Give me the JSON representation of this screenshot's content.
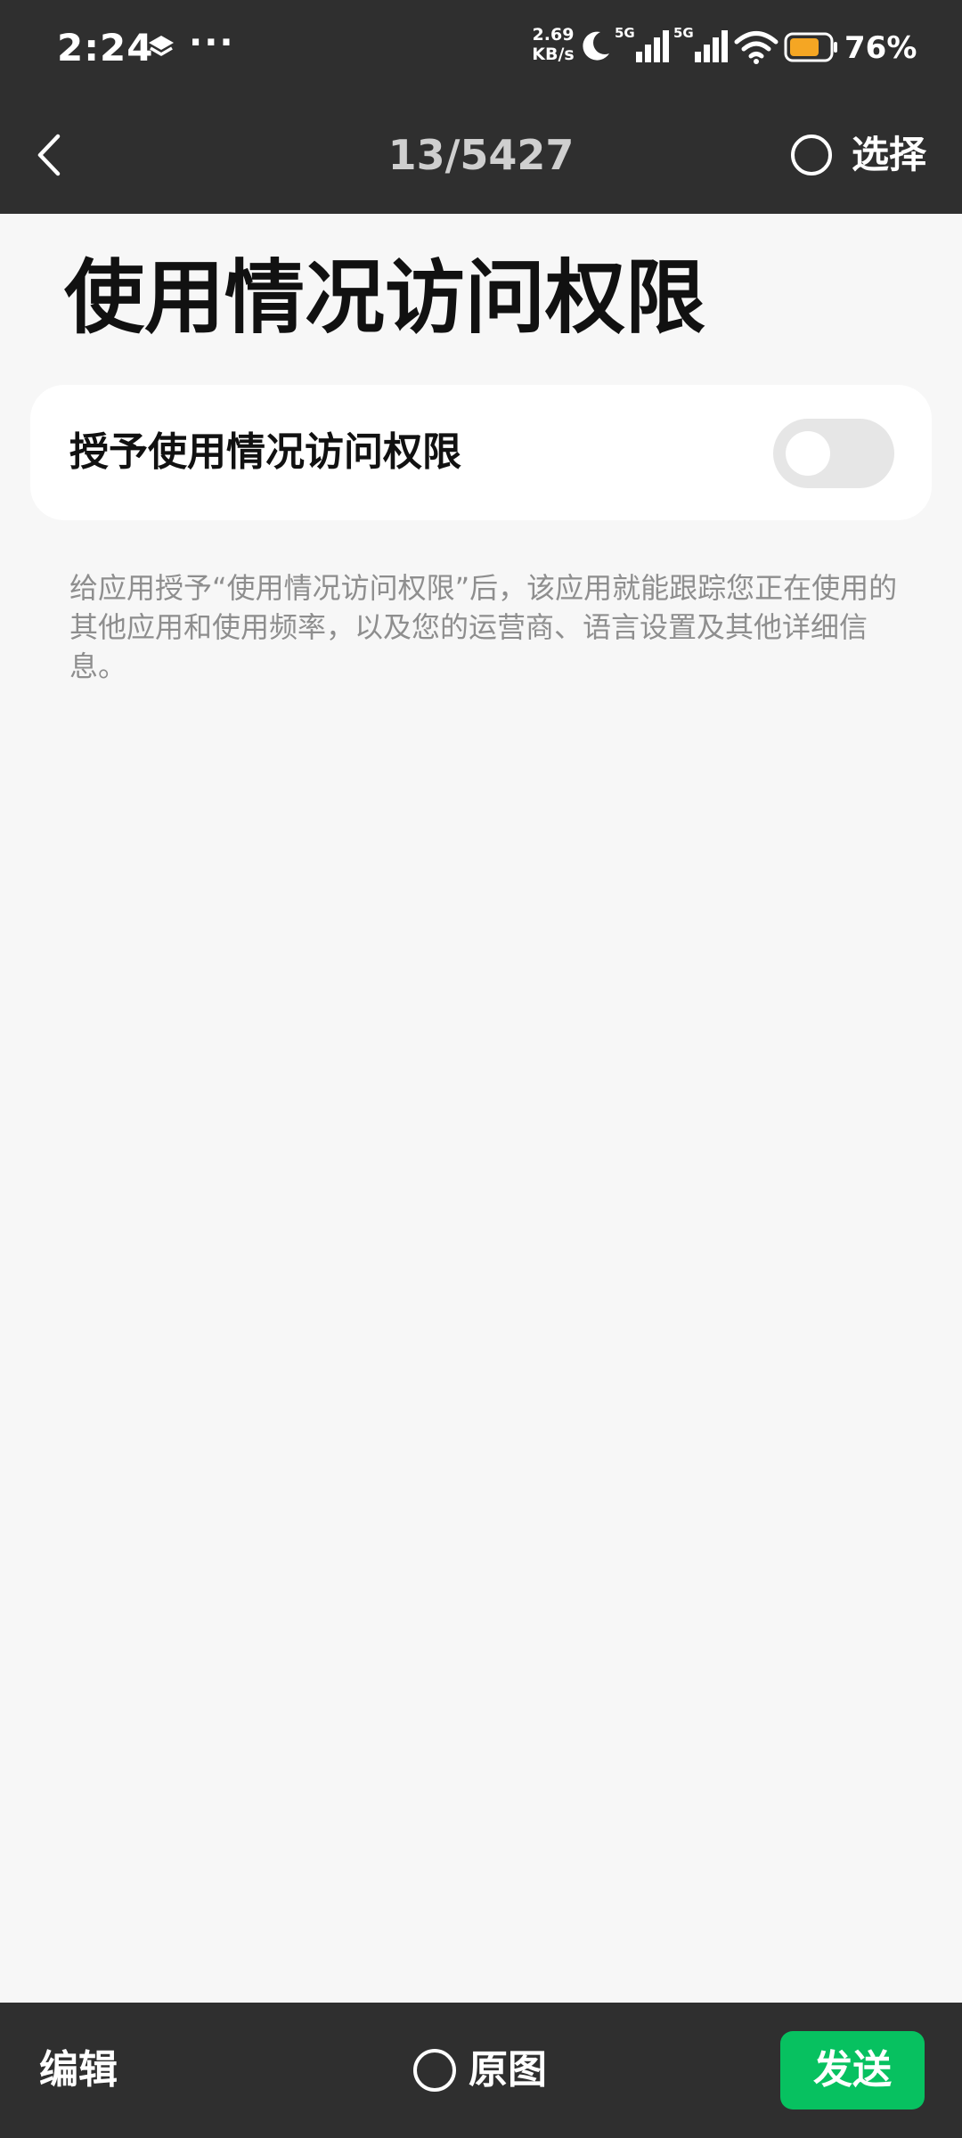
{
  "status_bar": {
    "time": "2:24",
    "more_dots": "···",
    "net_speed_value": "2.69",
    "net_speed_unit": "KB/s",
    "signal1_label": "5G",
    "signal2_label": "5G",
    "battery_percent": "76%",
    "battery_level": 0.76,
    "battery_color": "#f5a623",
    "icons": [
      "layers-icon",
      "moon-icon",
      "signal-icon",
      "signal-icon",
      "wifi-icon",
      "battery-icon"
    ]
  },
  "top_bar": {
    "counter": "13/5427",
    "select_label": "选择",
    "icons": [
      "back-chevron-icon",
      "select-circle-icon"
    ]
  },
  "content": {
    "title": "使用情况访问权限",
    "setting_label": "授予使用情况访问权限",
    "toggle_on": false,
    "description": "给应用授予“使用情况访问权限”后，该应用就能跟踪您正在使用的其他应用和使用频率，以及您的运营商、语言设置及其他详细信息。"
  },
  "bottom_bar": {
    "edit_label": "编辑",
    "original_label": "原图",
    "send_label": "发送",
    "send_color": "#07c160"
  }
}
